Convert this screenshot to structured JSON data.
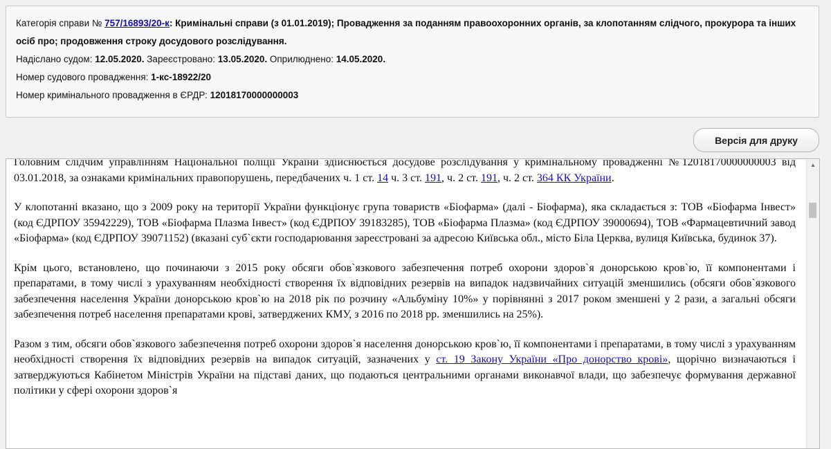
{
  "info": {
    "category_label": "Категорія справи № ",
    "case_link": "757/16893/20-к",
    "category_text": ": Кримінальні справи (з 01.01.2019); Провадження за поданням правоохоронних органів, за клопотанням слідчого, прокурора та інших осіб про; продовження строку досудового розслідування.",
    "sent_label": "Надіслано судом: ",
    "sent_date": "12.05.2020.",
    "registered_label": " Зареєстровано: ",
    "registered_date": "13.05.2020.",
    "published_label": " Оприлюднено: ",
    "published_date": "14.05.2020.",
    "court_case_label": "Номер судового провадження: ",
    "court_case_number": "1-кс-18922/20",
    "erdr_label": "Номер кримінального провадження в ЄРДР: ",
    "erdr_number": "12018170000000003"
  },
  "print_button": "Версія для друку",
  "document": {
    "p1": {
      "t1": "Головним слідчим управлінням Національної поліції України здійснюється досудове розслідування у кримінальному провадженні №12018170000000003 від 03.01.2018, за ознаками кримінальних правопорушень, передбачених ч. 1 ст. ",
      "l1": "14",
      "t2": " ч. 3 ст. ",
      "l2": "191",
      "t3": ", ч. 2 ст. ",
      "l3": "191",
      "t4": ", ч. 2 ст. ",
      "l4": "364 КК України",
      "t5": "."
    },
    "p2": "У клопотанні вказано, що з 2009 року на території України функціонує група товариств «Біофарма» (далі - Біофарма), яка складається з: ТОВ «Біофарма Інвест» (код ЄДРПОУ 35942229), ТОВ «Біофарма Плазма Інвест» (код ЄДРПОУ 39183285), ТОВ «Біофарма Плазма» (код ЄДРПОУ 39000694), ТОВ «Фармацевтичний завод «Біофарма» (код ЄДРПОУ 39071152) (вказані суб`єкти господарювання зареєстровані за адресою Київська обл., місто Біла Церква, вулиця Київська, будинок 37).",
    "p3": "Крім цього, встановлено, що починаючи з 2015 року обсяги обов`язкового забезпечення потреб охорони здоров`я донорською кров`ю, її компонентами і препаратами, в тому числі з урахуванням необхідності створення їх відповідних резервів на випадок надзвичайних ситуацій зменшились (обсяги обов`язкового забезпечення населення України донорською кров`ю на 2018 рік по розчину «Альбуміну 10%» у порівнянні з 2017 роком зменшені у 2 рази, а загальні обсяги забезпечення потреб населення препаратами крові, затверджених КМУ, з 2016 по 2018 рр. зменшились на 25%).",
    "p4": {
      "t1": "Разом з тим, обсяги обов`язкового забезпечення потреб охорони здоров`я населення донорською кров`ю, її компонентами і препаратами, в тому числі з урахуванням необхідності створення їх відповідних резервів на випадок ситуацій, зазначених у ",
      "l1": "ст. 19 Закону України «Про донорство крові»",
      "t2": ", щорічно визначаються і затверджуються Кабінетом Міністрів України на підставі даних, що подаються центральними органами виконавчої влади, що забезпечує формування державної політики у сфері охорони здоров`я"
    }
  }
}
